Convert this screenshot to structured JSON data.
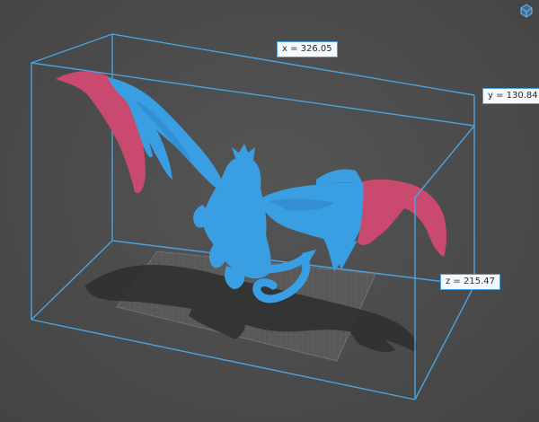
{
  "viewer": {
    "dimensions": {
      "x": "x = 326.05",
      "y": "y = 130.84",
      "z": "z = 215.47"
    },
    "view_cube_icon": "view-orientation-icon"
  },
  "colors": {
    "background": "#4b4b4b",
    "bounding_box": "#4aa3df",
    "model": "#3a9ee3",
    "overhang": "#c94a6e",
    "build_plate": "#5c5c5c",
    "shadow": "#2f2f2f"
  }
}
